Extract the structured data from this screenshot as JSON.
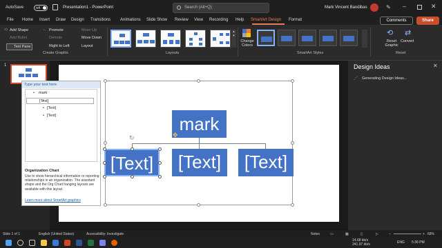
{
  "titlebar": {
    "autosave": "AutoSave",
    "toggle": "Off",
    "doc_title": "Presentation1 - PowerPoint",
    "search_placeholder": "Search (Alt+Q)",
    "user_name": "Mark Vincent Bandibas"
  },
  "menu": {
    "items": [
      "File",
      "Home",
      "Insert",
      "Draw",
      "Design",
      "Transitions",
      "Animations",
      "Slide Show",
      "Review",
      "View",
      "Recording",
      "Help",
      "SmartArt Design",
      "Format"
    ],
    "active": "SmartArt Design",
    "comments": "Comments",
    "share": "Share"
  },
  "ribbon": {
    "create_graphic": {
      "add_shape": "Add Shape",
      "add_bullet": "Add Bullet",
      "text_pane": "Text Pane",
      "promote": "Promote",
      "demote": "Demote",
      "right_to_left": "Right to Left",
      "move_up": "Move Up",
      "move_down": "Move Down",
      "layout": "Layout",
      "label": "Create Graphic"
    },
    "layouts_label": "Layouts",
    "change_colors": "Change Colors",
    "styles_label": "SmartArt Styles",
    "reset_graphic": "Reset Graphic",
    "convert": "Convert",
    "reset_label": "Reset"
  },
  "slides": {
    "number": "1"
  },
  "smartart": {
    "top": "mark",
    "children": [
      "[Text]",
      "[Text]",
      "[Text]"
    ]
  },
  "text_pane": {
    "header": "Type your text here",
    "items": [
      "mark",
      "[Text]",
      "[Text]",
      "[Text]"
    ],
    "info_title": "Organization Chart",
    "info_body": "Use to show hierarchical information or reporting relationships in an organization. The assistant shape and the Org Chart hanging layouts are available with this layout.",
    "link": "Learn more about SmartArt graphics"
  },
  "design_ideas": {
    "title": "Design Ideas",
    "status": "Generating Design Ideas..."
  },
  "status": {
    "slide": "Slide 1 of 1",
    "language": "English (United States)",
    "accessibility": "Accessibility: Investigate",
    "notes": "Notes",
    "zoom": "68%"
  },
  "taskbar": {
    "net_up": "14.68 kb/s",
    "net_down": "241.97 kb/s",
    "lang": "ENG",
    "time": "5:36 PM"
  },
  "colors": {
    "accent": "#ef7b5a",
    "node_blue": "#4472c4",
    "share": "#c94f2c"
  }
}
